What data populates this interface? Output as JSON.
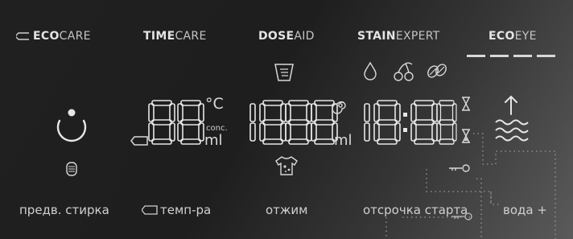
{
  "brands": [
    {
      "bold": "ECO",
      "rest": "CARE",
      "tag_icon": "tag-icon"
    },
    {
      "bold": "TIME",
      "rest": "CARE"
    },
    {
      "bold": "DOSE",
      "rest": "AID"
    },
    {
      "bold": "STAIN",
      "rest": "EXPERT"
    },
    {
      "bold": "ECO",
      "rest": "EYE"
    }
  ],
  "display": {
    "temperature_digits": "88",
    "temperature_unit": "°C",
    "conc_label": "conc.",
    "temperature_ml": "ml",
    "spin_digits": "1888",
    "spin_unit": "ml",
    "time_digits": "18:88"
  },
  "buttons": {
    "prewash": "предв. стирка",
    "temperature": "темп-ра",
    "spin": "отжим",
    "delay_start": "отсрочка старта",
    "water_plus": "вода +"
  },
  "icons": {
    "power": "power-icon",
    "drum": "drum-icon",
    "detergent": "detergent-dispenser-icon",
    "shirt": "stained-shirt-icon",
    "spin": "spin-swirl-icon",
    "drop": "drop-icon",
    "cherries": "cherries-icon",
    "coffee": "coffee-beans-icon",
    "hourglass": "hourglass-icon",
    "water_level": "water-level-icon",
    "key": "key-lock-icon"
  },
  "colors": {
    "background": "#1d1d1d",
    "segments": "#e6e6e6",
    "text": "#d0d0d0"
  }
}
